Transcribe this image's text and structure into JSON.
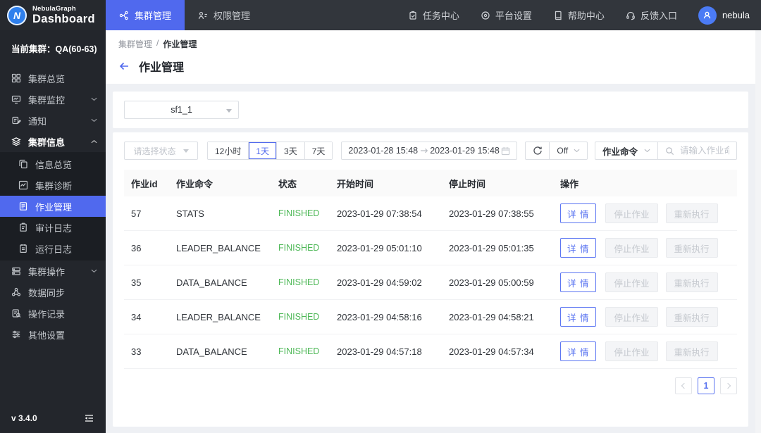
{
  "colors": {
    "accent": "#5069ee",
    "success_green": "#4eb857",
    "topbar_bg": "#32363c",
    "sidebar_bg": "#23262c",
    "page_bg": "#eef0f4"
  },
  "header": {
    "brand": {
      "name": "NebulaGraph",
      "product": "Dashboard",
      "logo_letter": "N"
    },
    "tabs": [
      {
        "label": "集群管理"
      },
      {
        "label": "权限管理"
      }
    ],
    "nav": [
      {
        "label": "任务中心"
      },
      {
        "label": "平台设置"
      },
      {
        "label": "帮助中心"
      },
      {
        "label": "反馈入口"
      }
    ],
    "user": "nebula"
  },
  "sidebar": {
    "cluster_label": "当前集群：QA(60-63)",
    "items": [
      {
        "label": "集群总览"
      },
      {
        "label": "集群监控"
      },
      {
        "label": "通知"
      },
      {
        "label": "集群信息"
      },
      {
        "label": "信息总览"
      },
      {
        "label": "集群诊断"
      },
      {
        "label": "作业管理"
      },
      {
        "label": "审计日志"
      },
      {
        "label": "运行日志"
      },
      {
        "label": "集群操作"
      },
      {
        "label": "数据同步"
      },
      {
        "label": "操作记录"
      },
      {
        "label": "其他设置"
      }
    ],
    "version": "v 3.4.0"
  },
  "page": {
    "breadcrumb": [
      "集群管理",
      "作业管理"
    ],
    "title": "作业管理"
  },
  "filters": {
    "space_select": "sf1_1",
    "status_placeholder": "请选择状态",
    "ranges": [
      "12小时",
      "1天",
      "3天",
      "7天"
    ],
    "active_range": "1天",
    "date_from": "2023-01-28 15:48",
    "date_to": "2023-01-29 15:48",
    "auto_refresh": "Off",
    "command_select": "作业命令",
    "search_placeholder": "请输入作业命令"
  },
  "table": {
    "columns": [
      "作业id",
      "作业命令",
      "状态",
      "开始时间",
      "停止时间",
      "操作"
    ],
    "rows": [
      {
        "id": "57",
        "command": "STATS",
        "status": "FINISHED",
        "start": "2023-01-29 07:38:54",
        "stop": "2023-01-29 07:38:55"
      },
      {
        "id": "36",
        "command": "LEADER_BALANCE",
        "status": "FINISHED",
        "start": "2023-01-29 05:01:10",
        "stop": "2023-01-29 05:01:35"
      },
      {
        "id": "35",
        "command": "DATA_BALANCE",
        "status": "FINISHED",
        "start": "2023-01-29 04:59:02",
        "stop": "2023-01-29 05:00:59"
      },
      {
        "id": "34",
        "command": "LEADER_BALANCE",
        "status": "FINISHED",
        "start": "2023-01-29 04:58:16",
        "stop": "2023-01-29 04:58:21"
      },
      {
        "id": "33",
        "command": "DATA_BALANCE",
        "status": "FINISHED",
        "start": "2023-01-29 04:57:18",
        "stop": "2023-01-29 04:57:34"
      }
    ],
    "actions": {
      "detail": "详 情",
      "stop": "停止作业",
      "rerun": "重新执行"
    }
  },
  "pagination": {
    "current": "1"
  }
}
